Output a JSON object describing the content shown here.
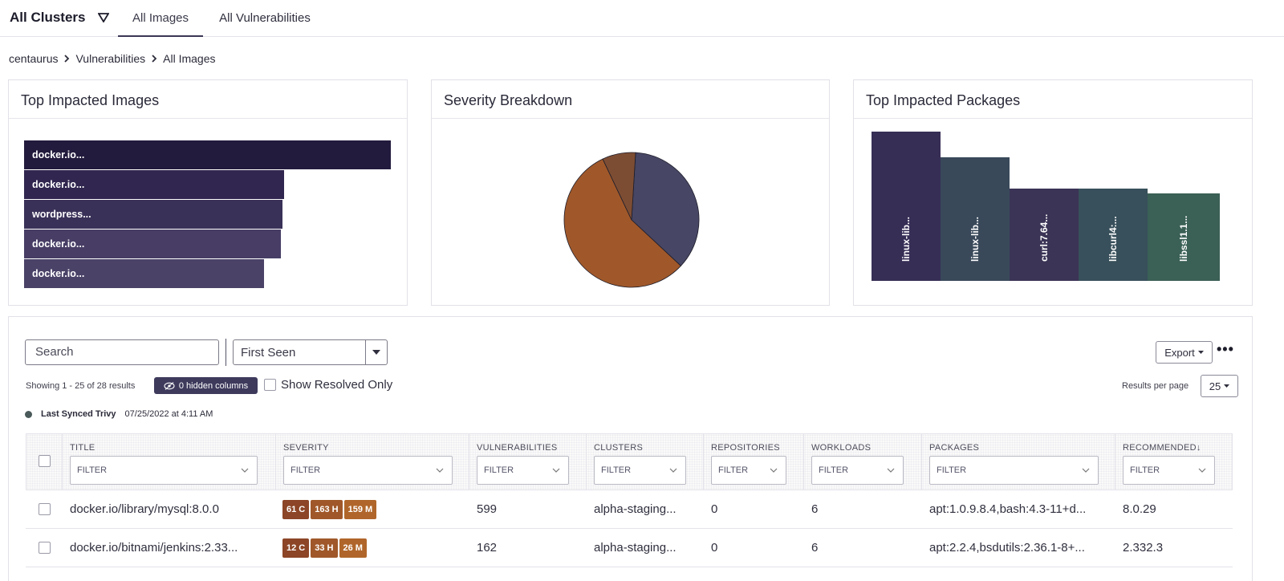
{
  "header": {
    "cluster_select": "All Clusters",
    "tabs": [
      {
        "label": "All Images",
        "active": true
      },
      {
        "label": "All Vulnerabilities",
        "active": false
      }
    ]
  },
  "breadcrumb": [
    "centaurus",
    "Vulnerabilities",
    "All Images"
  ],
  "cards": {
    "top_images": {
      "title": "Top Impacted Images",
      "bars": [
        {
          "label": "docker.io...",
          "value": 1.0,
          "color": "#231b3d"
        },
        {
          "label": "docker.io...",
          "value": 0.71,
          "color": "#30264f"
        },
        {
          "label": "wordpress...",
          "value": 0.705,
          "color": "#3a3158"
        },
        {
          "label": "docker.io...",
          "value": 0.7,
          "color": "#473d65"
        },
        {
          "label": "docker.io...",
          "value": 0.655,
          "color": "#4b4268"
        }
      ]
    },
    "severity": {
      "title": "Severity Breakdown",
      "chart_data": {
        "type": "pie",
        "slices": [
          {
            "value": 36,
            "color": "#474664"
          },
          {
            "value": 56,
            "color": "#a0582a"
          },
          {
            "value": 8,
            "color": "#7d4d33"
          }
        ]
      }
    },
    "top_packages": {
      "title": "Top Impacted Packages",
      "bars": [
        {
          "label": "linux-lib...",
          "value": 1.0,
          "color": "#372e56"
        },
        {
          "label": "linux-lib...",
          "value": 0.83,
          "color": "#39495a"
        },
        {
          "label": "curl:7.64...",
          "value": 0.62,
          "color": "#3b3456"
        },
        {
          "label": "libcurl4:...",
          "value": 0.62,
          "color": "#38505b"
        },
        {
          "label": "libssl1.1...",
          "value": 0.585,
          "color": "#3b6056"
        }
      ]
    }
  },
  "toolbar": {
    "search_placeholder": "Search",
    "sort_value": "First Seen",
    "export_label": "Export",
    "more_label": "•••",
    "showing_text": "Showing 1 - 25 of 28 results",
    "hidden_columns_label": "0 hidden columns",
    "show_resolved_label": "Show Resolved Only",
    "results_per_page_label": "Results per page",
    "results_per_page_value": "25",
    "last_synced_label": "Last Synced Trivy",
    "last_synced_value": "07/25/2022 at 4:11 AM"
  },
  "table": {
    "filter_placeholder": "FILTER",
    "columns": [
      "TITLE",
      "SEVERITY",
      "VULNERABILITIES",
      "CLUSTERS",
      "REPOSITORIES",
      "WORKLOADS",
      "PACKAGES",
      "RECOMMENDED"
    ],
    "sort_indicator": "↓",
    "rows": [
      {
        "title": "docker.io/library/mysql:8.0.0",
        "severity": [
          {
            "text": "61 C",
            "color": "#8c4526"
          },
          {
            "text": "163 H",
            "color": "#a0582a"
          },
          {
            "text": "159 M",
            "color": "#b0662a"
          }
        ],
        "vulnerabilities": "599",
        "clusters": "alpha-staging...",
        "repositories": "0",
        "workloads": "6",
        "packages": "apt:1.0.9.8.4,bash:4.3-11+d...",
        "recommended": "8.0.29"
      },
      {
        "title": "docker.io/bitnami/jenkins:2.33...",
        "severity": [
          {
            "text": "12 C",
            "color": "#8c4526"
          },
          {
            "text": "33 H",
            "color": "#a0582a"
          },
          {
            "text": "26 M",
            "color": "#b0662a"
          }
        ],
        "vulnerabilities": "162",
        "clusters": "alpha-staging...",
        "repositories": "0",
        "workloads": "6",
        "packages": "apt:2.2.4,bsdutils:2.36.1-8+...",
        "recommended": "2.332.3"
      }
    ]
  }
}
